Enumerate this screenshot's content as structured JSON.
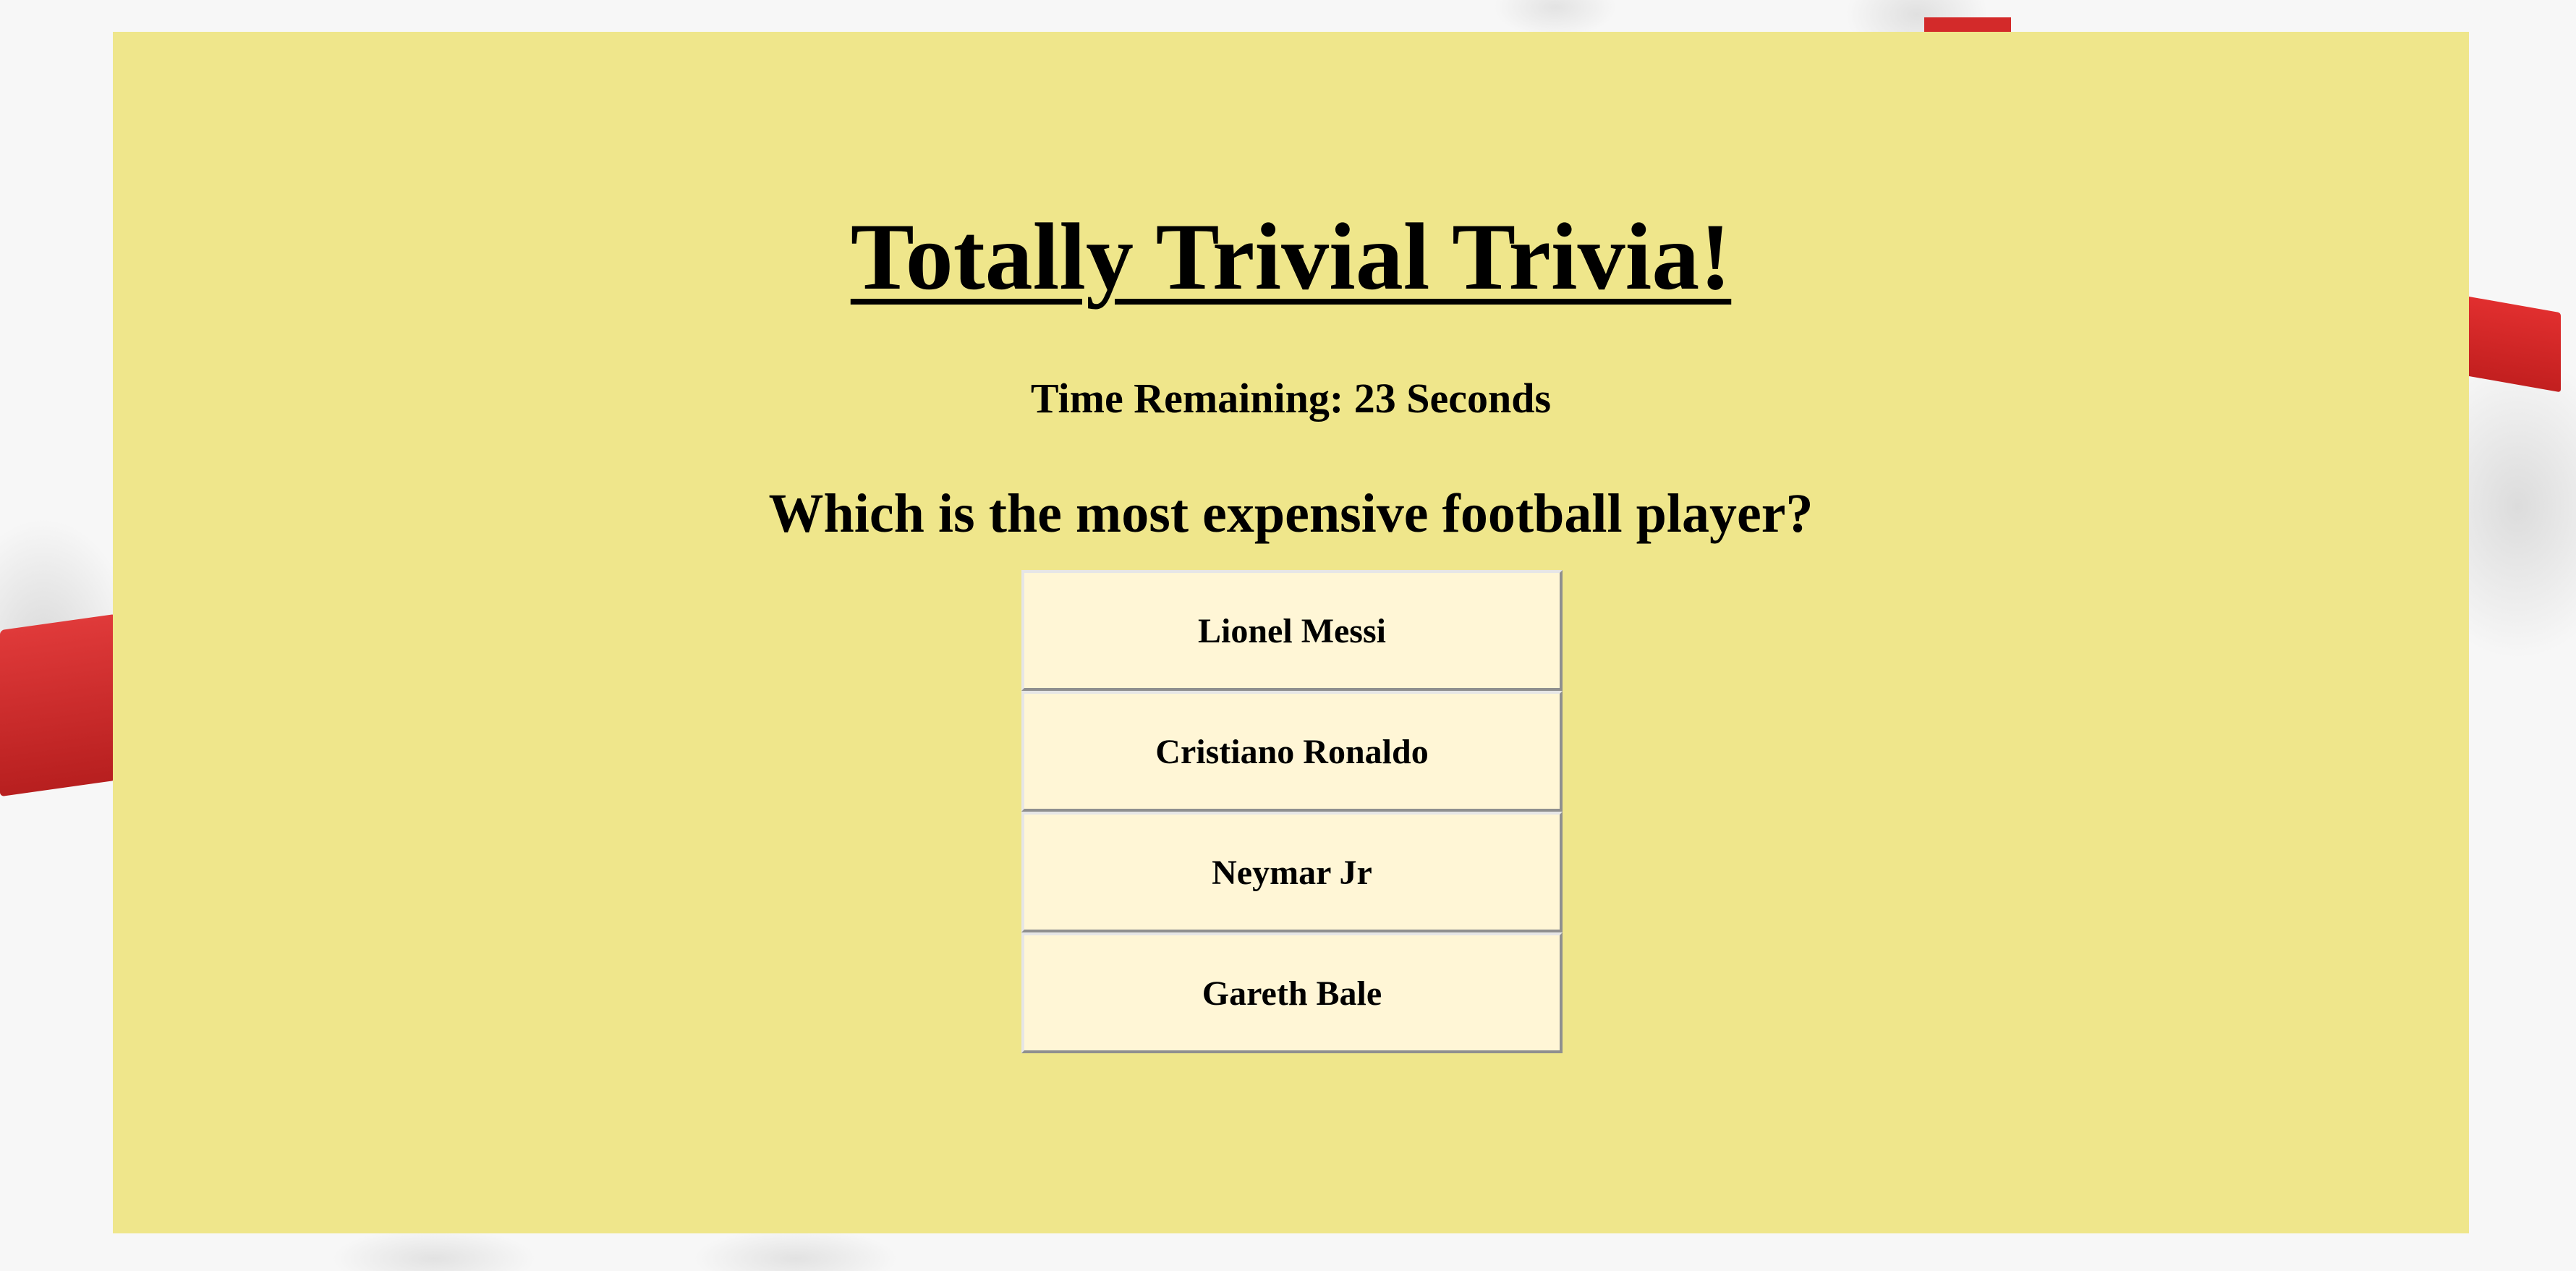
{
  "app": {
    "title": "Totally Trivial Trivia!"
  },
  "timer": {
    "text": "Time Remaining: 23 Seconds"
  },
  "question": {
    "text": "Which is the most expensive football player?"
  },
  "answers": [
    {
      "label": "Lionel Messi"
    },
    {
      "label": "Cristiano Ronaldo"
    },
    {
      "label": "Neymar Jr"
    },
    {
      "label": "Gareth Bale"
    }
  ],
  "colors": {
    "panel_background": "#efe68b",
    "button_background": "#fff6d6",
    "text": "#000000",
    "accent_red": "#d32a2a"
  }
}
